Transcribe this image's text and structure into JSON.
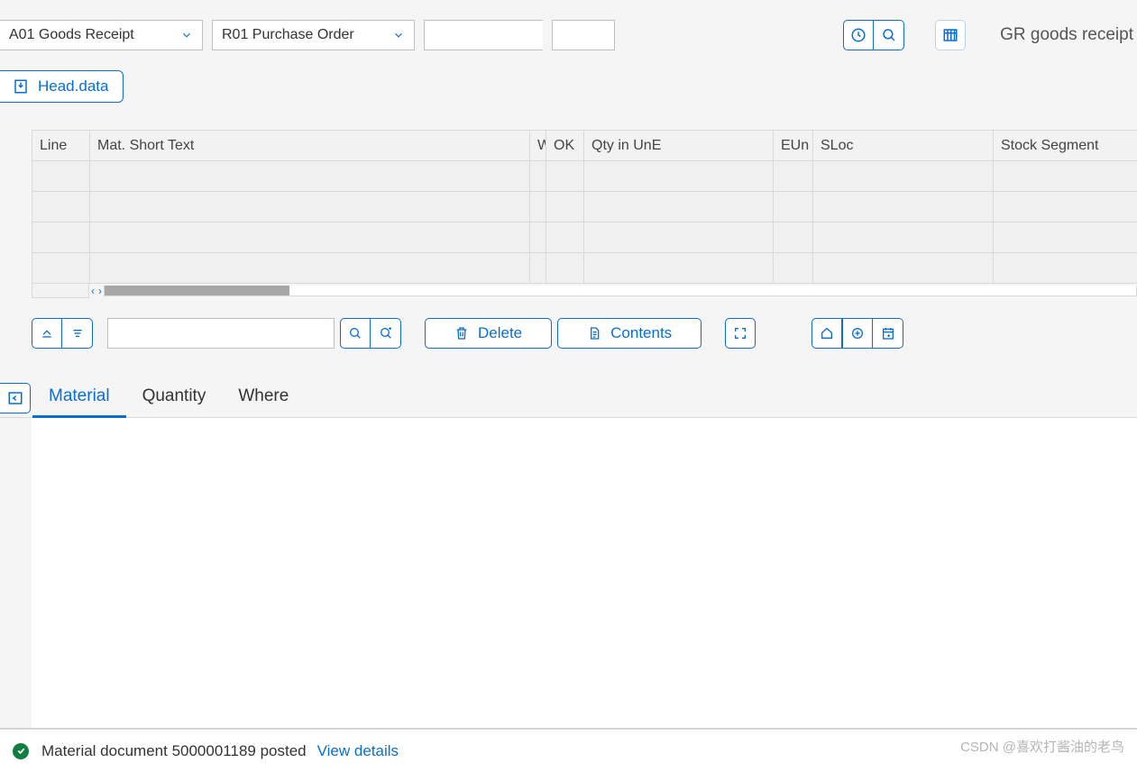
{
  "header": {
    "transaction_value": "A01 Goods Receipt",
    "reference_value": "R01 Purchase Order",
    "doc_value": "",
    "year_value": "",
    "page_title": "GR goods receipt"
  },
  "head_data_button": "Head.data",
  "table": {
    "columns": [
      "Line",
      "Mat. Short Text",
      "W",
      "OK",
      "Qty in UnE",
      "EUn",
      "SLoc",
      "Stock Segment"
    ],
    "row_count": 4
  },
  "mid_toolbar": {
    "search_value": "",
    "delete_label": "Delete",
    "contents_label": "Contents"
  },
  "tabs": {
    "items": [
      "Material",
      "Quantity",
      "Where"
    ],
    "active_index": 0
  },
  "status": {
    "message": "Material document 5000001189 posted",
    "link_label": "View details"
  },
  "watermark": "CSDN @喜欢打酱油的老鸟"
}
